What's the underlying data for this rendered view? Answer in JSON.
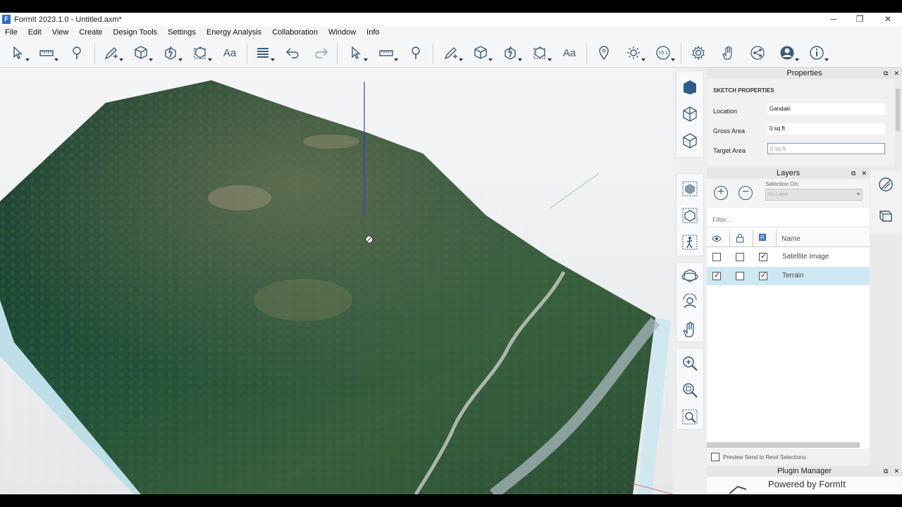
{
  "window": {
    "title": "FormIt 2023.1.0 - Untitled.axm*",
    "minimize": "─",
    "maximize": "❐",
    "close": "✕"
  },
  "menu": [
    "File",
    "Edit",
    "View",
    "Create",
    "Design Tools",
    "Settings",
    "Energy Analysis",
    "Collaboration",
    "Window",
    "Info"
  ],
  "toolbar": {
    "scale_label": "19.1",
    "text_tool_label": "Aa"
  },
  "properties": {
    "title": "Properties",
    "section": "SKETCH PROPERTIES",
    "location_label": "Location",
    "location_value": "Gandaki",
    "gross_area_label": "Gross Area",
    "gross_area_value": "0 sq ft",
    "target_area_label": "Target Area",
    "target_area_placeholder": "0 sq ft"
  },
  "layers": {
    "title": "Layers",
    "selection_on_label": "Selection On:",
    "selection_value": "No Layer",
    "filter_placeholder": "Filter...",
    "name_header": "Name",
    "rows": [
      {
        "name": "Satellite Image",
        "visible": false,
        "locked": false,
        "selected": true,
        "highlighted": false
      },
      {
        "name": "Terrain",
        "visible": true,
        "locked": false,
        "selected": true,
        "highlighted": true
      }
    ],
    "preview_label": "Preview Send to Revit Selections"
  },
  "plugin_manager": {
    "title": "Plugin Manager",
    "powered_by": "Powered by FormIt"
  },
  "colors": {
    "accent": "#2d6fc1",
    "highlight_row": "#cde8f3",
    "icon_blue": "#3d5a7a"
  }
}
